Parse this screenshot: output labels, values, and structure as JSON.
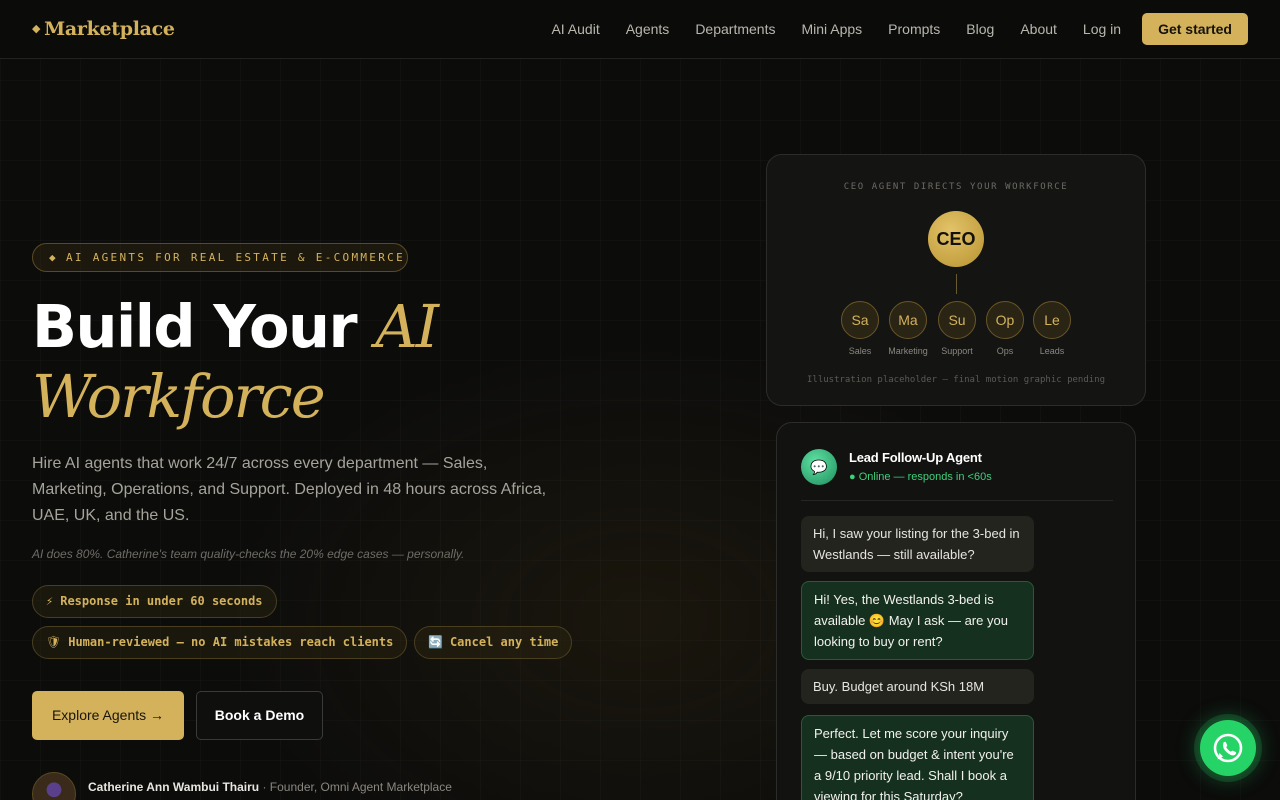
{
  "nav": {
    "logo_mark": "◆",
    "logo_text": "Marketplace",
    "links": [
      "AI Audit",
      "Agents",
      "Departments",
      "Mini Apps",
      "Prompts",
      "Blog",
      "About",
      "Log in"
    ],
    "cta": "Get started"
  },
  "hero": {
    "tag_icon": "◆",
    "tag": "AI AGENTS FOR REAL ESTATE & E-COMMERCE",
    "title_line1": "Build Your ",
    "title_accent1": "AI",
    "title_accent2": "Workforce",
    "lede": "Hire AI agents that work 24/7 across every department — Sales, Marketing, Operations, and Support. Deployed in 48 hours across Africa, UAE, UK, and the US.",
    "note": "AI does 80%. Catherine's team quality-checks the 20% edge cases — personally.",
    "badges": [
      {
        "icon": "⚡",
        "text": "Response in under 60 seconds"
      },
      {
        "icon": "🛡",
        "text": "Human-reviewed — no AI mistakes reach clients"
      },
      {
        "icon": "🔄",
        "text": "Cancel any time"
      }
    ],
    "primary_cta": "Explore Agents →",
    "secondary_cta": "Book a Demo",
    "founder_name": "Catherine Ann Wambui Thairu",
    "founder_role": " · Founder, Omni Agent Marketplace"
  },
  "org": {
    "title": "CEO AGENT DIRECTS YOUR WORKFORCE",
    "ceo": "CEO",
    "departments": [
      {
        "abbr": "Sa",
        "label": "Sales"
      },
      {
        "abbr": "Ma",
        "label": "Marketing"
      },
      {
        "abbr": "Su",
        "label": "Support"
      },
      {
        "abbr": "Op",
        "label": "Ops"
      },
      {
        "abbr": "Le",
        "label": "Leads"
      }
    ],
    "footer": "Illustration placeholder — final motion graphic pending"
  },
  "chat": {
    "avatar_icon": "💬",
    "agent_name": "Lead Follow-Up Agent",
    "status": "● Online — responds in <60s",
    "messages": [
      {
        "from": "user",
        "text": "Hi, I saw your listing for the 3-bed in Westlands — still available?"
      },
      {
        "from": "agent",
        "text": "Hi! Yes, the Westlands 3-bed is available 😊 May I ask — are you looking to buy or rent?"
      },
      {
        "from": "user",
        "text": "Buy. Budget around KSh 18M"
      },
      {
        "from": "agent",
        "text": "Perfect. Let me score your inquiry — based on budget & intent you're a 9/10 priority lead. Shall I book a viewing for this Saturday?"
      }
    ]
  },
  "whatsapp": {
    "icon": "whatsapp-icon",
    "color": "#25d366"
  },
  "colors": {
    "accent": "#d4b25c",
    "background": "#0c0c0b",
    "online": "#3ecf7a"
  }
}
